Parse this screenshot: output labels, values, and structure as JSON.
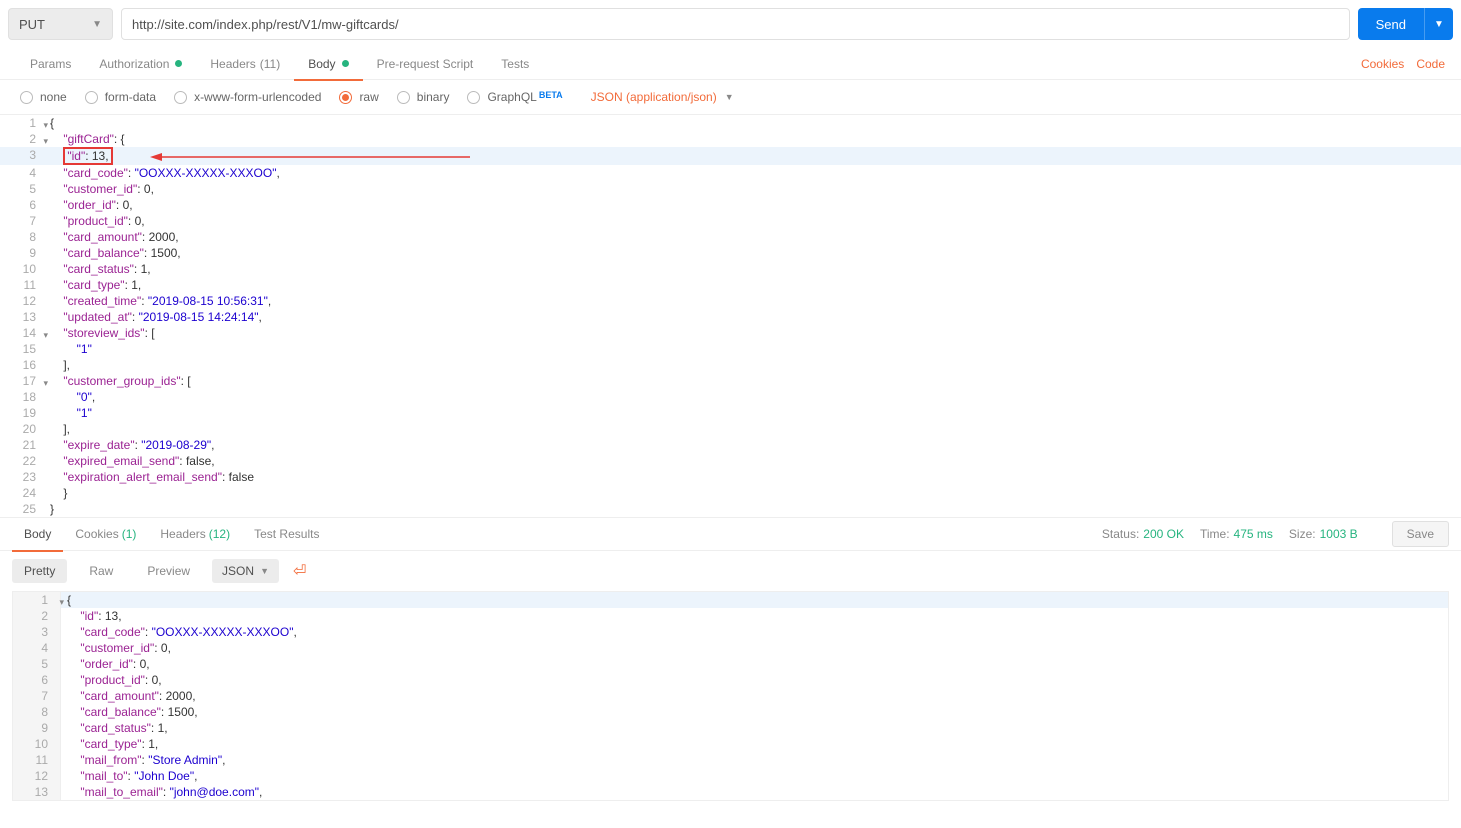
{
  "method": "PUT",
  "url": "http://site.com/index.php/rest/V1/mw-giftcards/",
  "send_label": "Send",
  "tabs": {
    "params": "Params",
    "auth": "Authorization",
    "headers": "Headers",
    "headers_count": "(11)",
    "body": "Body",
    "prerequest": "Pre-request Script",
    "tests": "Tests"
  },
  "right_links": {
    "cookies": "Cookies",
    "code": "Code"
  },
  "body_types": {
    "none": "none",
    "formdata": "form-data",
    "urlencoded": "x-www-form-urlencoded",
    "raw": "raw",
    "binary": "binary",
    "graphql": "GraphQL",
    "beta": "BETA"
  },
  "content_type": "JSON (application/json)",
  "request_body": {
    "giftCard_key": "\"giftCard\"",
    "id_key": "\"id\"",
    "id_val": "13",
    "card_code_key": "\"card_code\"",
    "card_code_val": "\"OOXXX-XXXXX-XXXOO\"",
    "customer_id_key": "\"customer_id\"",
    "customer_id_val": "0",
    "order_id_key": "\"order_id\"",
    "order_id_val": "0",
    "product_id_key": "\"product_id\"",
    "product_id_val": "0",
    "card_amount_key": "\"card_amount\"",
    "card_amount_val": "2000",
    "card_balance_key": "\"card_balance\"",
    "card_balance_val": "1500",
    "card_status_key": "\"card_status\"",
    "card_status_val": "1",
    "card_type_key": "\"card_type\"",
    "card_type_val": "1",
    "created_time_key": "\"created_time\"",
    "created_time_val": "\"2019-08-15 10:56:31\"",
    "updated_at_key": "\"updated_at\"",
    "updated_at_val": "\"2019-08-15 14:24:14\"",
    "storeview_ids_key": "\"storeview_ids\"",
    "sv1": "\"1\"",
    "customer_group_ids_key": "\"customer_group_ids\"",
    "cg0": "\"0\"",
    "cg1": "\"1\"",
    "expire_date_key": "\"expire_date\"",
    "expire_date_val": "\"2019-08-29\"",
    "expired_email_send_key": "\"expired_email_send\"",
    "expired_email_send_val": "false",
    "expiration_alert_email_send_key": "\"expiration_alert_email_send\"",
    "expiration_alert_email_send_val": "false"
  },
  "response_tabs": {
    "body": "Body",
    "cookies": "Cookies",
    "cookies_count": "(1)",
    "headers": "Headers",
    "headers_count": "(12)",
    "test_results": "Test Results"
  },
  "status": {
    "status_label": "Status:",
    "status_val": "200 OK",
    "time_label": "Time:",
    "time_val": "475 ms",
    "size_label": "Size:",
    "size_val": "1003 B",
    "save": "Save"
  },
  "view": {
    "pretty": "Pretty",
    "raw": "Raw",
    "preview": "Preview",
    "format": "JSON"
  },
  "response_body": {
    "id_key": "\"id\"",
    "id_val": "13",
    "card_code_key": "\"card_code\"",
    "card_code_val": "\"OOXXX-XXXXX-XXXOO\"",
    "customer_id_key": "\"customer_id\"",
    "customer_id_val": "0",
    "order_id_key": "\"order_id\"",
    "order_id_val": "0",
    "product_id_key": "\"product_id\"",
    "product_id_val": "0",
    "card_amount_key": "\"card_amount\"",
    "card_amount_val": "2000",
    "card_balance_key": "\"card_balance\"",
    "card_balance_val": "1500",
    "card_status_key": "\"card_status\"",
    "card_status_val": "1",
    "card_type_key": "\"card_type\"",
    "card_type_val": "1",
    "mail_from_key": "\"mail_from\"",
    "mail_from_val": "\"Store Admin\"",
    "mail_to_key": "\"mail_to\"",
    "mail_to_val": "\"John Doe\"",
    "mail_to_email_key": "\"mail_to_email\"",
    "mail_to_email_val": "\"john@doe.com\""
  }
}
